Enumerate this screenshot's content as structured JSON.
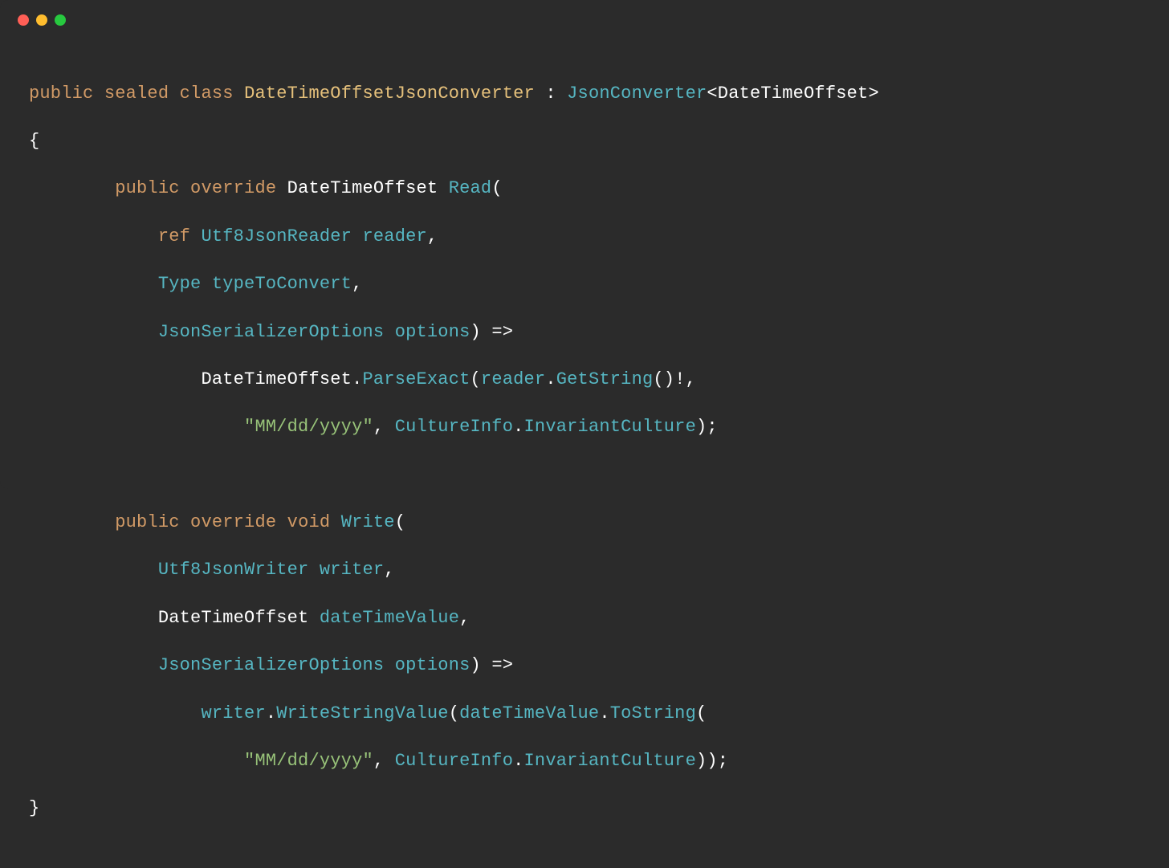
{
  "code": {
    "t": {
      "public": "public",
      "sealed": "sealed",
      "class": "class",
      "override": "override",
      "ref": "ref",
      "void": "void"
    },
    "class_name": "DateTimeOffsetJsonConverter",
    "base_type": "JsonConverter",
    "generic_arg": "DateTimeOffset",
    "read": {
      "return_type": "DateTimeOffset",
      "name": "Read",
      "p1_type": "Utf8JsonReader",
      "p1_name": "reader",
      "p2_type": "Type",
      "p2_name": "typeToConvert",
      "p3_type": "JsonSerializerOptions",
      "p3_name": "options",
      "body_type": "DateTimeOffset",
      "body_method": "ParseExact",
      "arg1_obj": "reader",
      "arg1_method": "GetString",
      "fmt": "\"MM/dd/yyyy\"",
      "culture_type": "CultureInfo",
      "culture_prop": "InvariantCulture"
    },
    "write": {
      "name": "Write",
      "p1_type": "Utf8JsonWriter",
      "p1_name": "writer",
      "p2_type": "DateTimeOffset",
      "p2_name": "dateTimeValue",
      "p3_type": "JsonSerializerOptions",
      "p3_name": "options",
      "body_obj": "writer",
      "body_method": "WriteStringValue",
      "arg_obj": "dateTimeValue",
      "arg_method": "ToString",
      "fmt": "\"MM/dd/yyyy\"",
      "culture_type": "CultureInfo",
      "culture_prop": "InvariantCulture"
    },
    "sym": {
      "colon": ":",
      "lt": "<",
      "gt": ">",
      "lparen": "(",
      "rparen": ")",
      "lbrace": "{",
      "rbrace": "}",
      "comma": ",",
      "dot": ".",
      "arrow": "=>",
      "bang": "!",
      "semi": ";"
    }
  }
}
